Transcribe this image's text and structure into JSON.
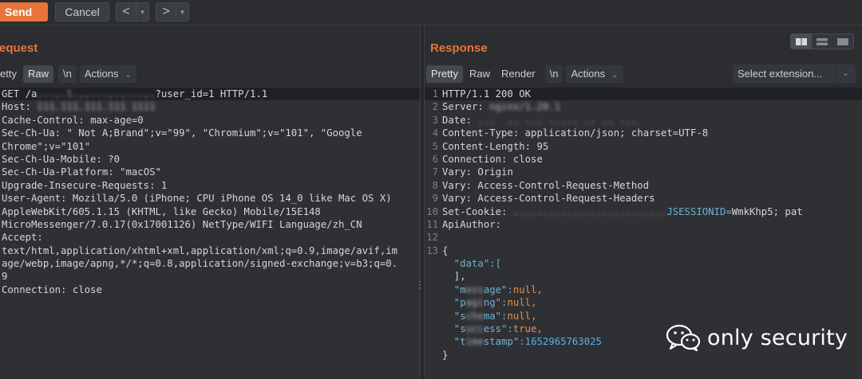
{
  "toolbar": {
    "send_label": "Send",
    "cancel_label": "Cancel",
    "back_glyph": "<",
    "forward_glyph": ">",
    "dropdown_glyph": "▾"
  },
  "request": {
    "title": "equest",
    "tabs": [
      "etty",
      "Raw",
      "\\n",
      "Actions"
    ],
    "lines": [
      {
        "k": "GET /a",
        "blur": "...,.l.,,...,.,...,.",
        "v": "?user_id=1 HTTP/1.1"
      },
      {
        "k": "Host: ",
        "blur": "111.111.111.111 1111",
        "v": ""
      },
      {
        "k": "Cache-Control: ",
        "v": "max-age=0"
      },
      {
        "k": "Sec-Ch-Ua: ",
        "v": "\" Not A;Brand\";v=\"99\", \"Chromium\";v=\"101\", \"Google"
      },
      {
        "k": "",
        "v": "Chrome\";v=\"101\""
      },
      {
        "k": "Sec-Ch-Ua-Mobile: ",
        "v": "?0"
      },
      {
        "k": "Sec-Ch-Ua-Platform: ",
        "v": "\"macOS\""
      },
      {
        "k": "Upgrade-Insecure-Requests: ",
        "v": "1"
      },
      {
        "k": "User-Agent: ",
        "v": "Mozilla/5.0 (iPhone; CPU iPhone OS 14_0 like Mac OS X)"
      },
      {
        "k": "",
        "v": "AppleWebKit/605.1.15 (KHTML, like Gecko) Mobile/15E148"
      },
      {
        "k": "",
        "v": "MicroMessenger/7.0.17(0x17001126) NetType/WIFI Language/zh_CN"
      },
      {
        "k": "Accept: ",
        "v": ""
      },
      {
        "k": "",
        "v": "text/html,application/xhtml+xml,application/xml;q=0.9,image/avif,im"
      },
      {
        "k": "",
        "v": "age/webp,image/apng,*/*;q=0.8,application/signed-exchange;v=b3;q=0."
      },
      {
        "k": "",
        "v": "9"
      },
      {
        "k": "Connection: ",
        "v": "close"
      }
    ]
  },
  "response": {
    "title": "Response",
    "tabs": [
      "Pretty",
      "Raw",
      "Render",
      "\\n",
      "Actions"
    ],
    "select_extension": "Select extension...",
    "lines": [
      {
        "n": "1",
        "k": "HTTP/1.1 200 OK",
        "v": ""
      },
      {
        "n": "2",
        "k": "Server: ",
        "blur": "nginx/1.20.1",
        "v": ""
      },
      {
        "n": "3",
        "k": "Date: ",
        "blur": "...  .. ... ..... .. .. ...",
        "v": ""
      },
      {
        "n": "4",
        "k": "Content-Type: ",
        "v": "application/json; charset=UTF-8"
      },
      {
        "n": "5",
        "k": "Content-Length: ",
        "v": "95"
      },
      {
        "n": "6",
        "k": "Connection: ",
        "v": "close"
      },
      {
        "n": "7",
        "k": "Vary: ",
        "v": "Origin"
      },
      {
        "n": "8",
        "k": "Vary: ",
        "v": "Access-Control-Request-Method"
      },
      {
        "n": "9",
        "k": "Vary: ",
        "v": "Access-Control-Request-Headers"
      },
      {
        "n": "10",
        "k": "Set-Cookie: ",
        "v": "JSESSIONID=",
        "blur": "..........................",
        "v2": "WmkKhp5; pat"
      },
      {
        "n": "11",
        "k": "ApiAuthor:",
        "v": ""
      },
      {
        "n": "12",
        "k": "",
        "v": ""
      },
      {
        "n": "13",
        "k": "{",
        "v": ""
      },
      {
        "n": "",
        "k": "  \"data\":[",
        "v": ""
      },
      {
        "n": "",
        "k": "  ],",
        "v": ""
      },
      {
        "n": "",
        "k": "  \"m",
        "blur": "ess",
        "k2": "age\":",
        "v": "null,"
      },
      {
        "n": "",
        "k": "  \"p",
        "blur": "agi",
        "k2": "ng\":",
        "v": "null,"
      },
      {
        "n": "",
        "k": "  \"s",
        "blur": "che",
        "k2": "ma\":",
        "v": "null,"
      },
      {
        "n": "",
        "k": "  \"s",
        "blur": "ucc",
        "k2": "ess\":",
        "v": "true,"
      },
      {
        "n": "",
        "k": "  \"t",
        "blur": "ime",
        "k2": "stamp\":",
        "v": "1652965763025"
      },
      {
        "n": "",
        "k": "}",
        "v": ""
      }
    ]
  },
  "watermark": {
    "text": "only security"
  }
}
